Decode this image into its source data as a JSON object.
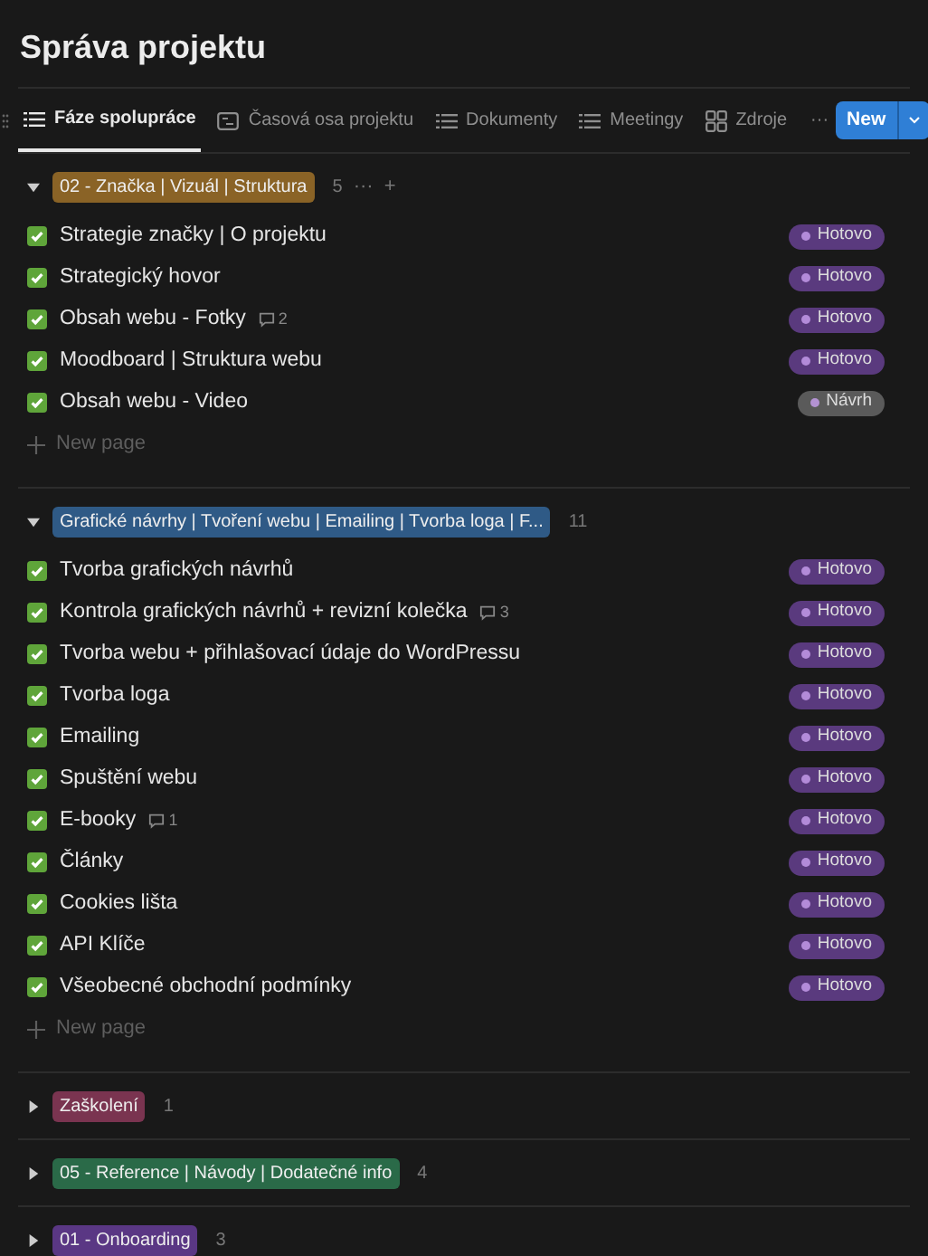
{
  "title": "Správa projektu",
  "tabs": [
    {
      "label": "Fáze spolupráce",
      "kind": "list",
      "selected": true
    },
    {
      "label": "Časová osa projektu",
      "kind": "timeline",
      "selected": false
    },
    {
      "label": "Dokumenty",
      "kind": "list",
      "selected": false
    },
    {
      "label": "Meetingy",
      "kind": "list",
      "selected": false
    },
    {
      "label": "Zdroje",
      "kind": "gallery",
      "selected": false
    }
  ],
  "more_tabs": "···",
  "new_button": "New",
  "groups": [
    {
      "label": "02 - Značka | Vizuál | Struktura",
      "color": "#8a6326",
      "count": "5",
      "expanded": true,
      "actions": [
        "···",
        "+"
      ],
      "new_page": "New page",
      "rows": [
        {
          "title": "Strategie značky | O projektu",
          "checked": true,
          "status": "Hotovo",
          "color": "#5a3a7e"
        },
        {
          "title": "Strategický hovor",
          "checked": true,
          "status": "Hotovo",
          "color": "#5a3a7e"
        },
        {
          "title": "Obsah webu - Fotky",
          "checked": true,
          "comments": "2",
          "status": "Hotovo",
          "color": "#5a3a7e"
        },
        {
          "title": "Moodboard | Struktura webu",
          "checked": true,
          "status": "Hotovo",
          "color": "#5a3a7e"
        },
        {
          "title": "Obsah webu - Video",
          "checked": true,
          "status": "Návrh",
          "color": "#5a5a5a"
        }
      ]
    },
    {
      "label": "Grafické návrhy | Tvoření webu | Emailing | Tvorba loga | F...",
      "color": "#2f5a86",
      "count": "11",
      "expanded": true,
      "new_page": "New page",
      "rows": [
        {
          "title": "Tvorba grafických návrhů",
          "checked": true,
          "status": "Hotovo",
          "color": "#5a3a7e"
        },
        {
          "title": "Kontrola grafických návrhů + revizní kolečka",
          "checked": true,
          "comments": "3",
          "status": "Hotovo",
          "color": "#5a3a7e"
        },
        {
          "title": "Tvorba webu + přihlašovací údaje do WordPressu",
          "checked": true,
          "status": "Hotovo",
          "color": "#5a3a7e"
        },
        {
          "title": "Tvorba loga",
          "checked": true,
          "status": "Hotovo",
          "color": "#5a3a7e"
        },
        {
          "title": "Emailing",
          "checked": true,
          "status": "Hotovo",
          "color": "#5a3a7e"
        },
        {
          "title": "Spuštění webu",
          "checked": true,
          "status": "Hotovo",
          "color": "#5a3a7e"
        },
        {
          "title": "E-booky",
          "checked": true,
          "comments": "1",
          "status": "Hotovo",
          "color": "#5a3a7e"
        },
        {
          "title": "Články",
          "checked": true,
          "status": "Hotovo",
          "color": "#5a3a7e"
        },
        {
          "title": "Cookies lišta",
          "checked": true,
          "status": "Hotovo",
          "color": "#5a3a7e"
        },
        {
          "title": "API Klíče",
          "checked": true,
          "status": "Hotovo",
          "color": "#5a3a7e"
        },
        {
          "title": "Všeobecné obchodní podmínky",
          "checked": true,
          "status": "Hotovo",
          "color": "#5a3a7e"
        }
      ]
    },
    {
      "label": "Zaškolení",
      "color": "#7a3450",
      "count": "1",
      "expanded": false
    },
    {
      "label": "05 - Reference | Návody | Dodatečné info",
      "color": "#2a6a48",
      "count": "4",
      "expanded": false
    },
    {
      "label": "01 - Onboarding",
      "color": "#5a3784",
      "count": "3",
      "expanded": false
    }
  ]
}
